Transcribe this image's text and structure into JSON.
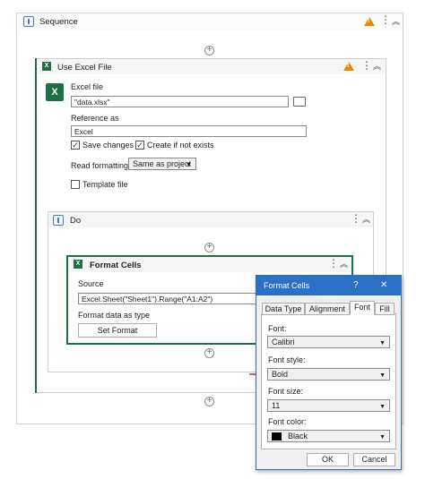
{
  "sequence": {
    "title": "Sequence"
  },
  "excel_scope": {
    "title": "Use Excel File",
    "excel_file_label": "Excel file",
    "excel_file_value": "\"data.xlsx\"",
    "reference_label": "Reference as",
    "reference_value": "Excel",
    "save_changes_label": "Save changes",
    "save_changes_checked": true,
    "create_label": "Create if not exists",
    "create_checked": true,
    "read_formatting_label": "Read formatting",
    "read_formatting_value": "Same as project",
    "template_label": "Template file",
    "template_checked": false
  },
  "do_block": {
    "title": "Do"
  },
  "format_cells": {
    "title": "Format Cells",
    "source_label": "Source",
    "source_value": "Excel.Sheet(\"Sheet1\").Range(\"A1:A2\")",
    "format_label": "Format data as type",
    "set_format_label": "Set Format"
  },
  "dialog": {
    "title": "Format Cells",
    "help": "?",
    "close": "✕",
    "tabs": [
      "Data Type",
      "Alignment",
      "Font",
      "Fill"
    ],
    "active_tab": "Font",
    "font_label": "Font:",
    "font_value": "Calibri",
    "style_label": "Font style:",
    "style_value": "Bold",
    "size_label": "Font size:",
    "size_value": "11",
    "color_label": "Font color:",
    "color_value": "Black",
    "color_swatch": "#000000",
    "ok_label": "OK",
    "cancel_label": "Cancel"
  },
  "colors": {
    "accent_blue": "#2b6fc6",
    "excel_green": "#1d7044",
    "warning": "#e28a00",
    "arrow": "#d9232a"
  }
}
